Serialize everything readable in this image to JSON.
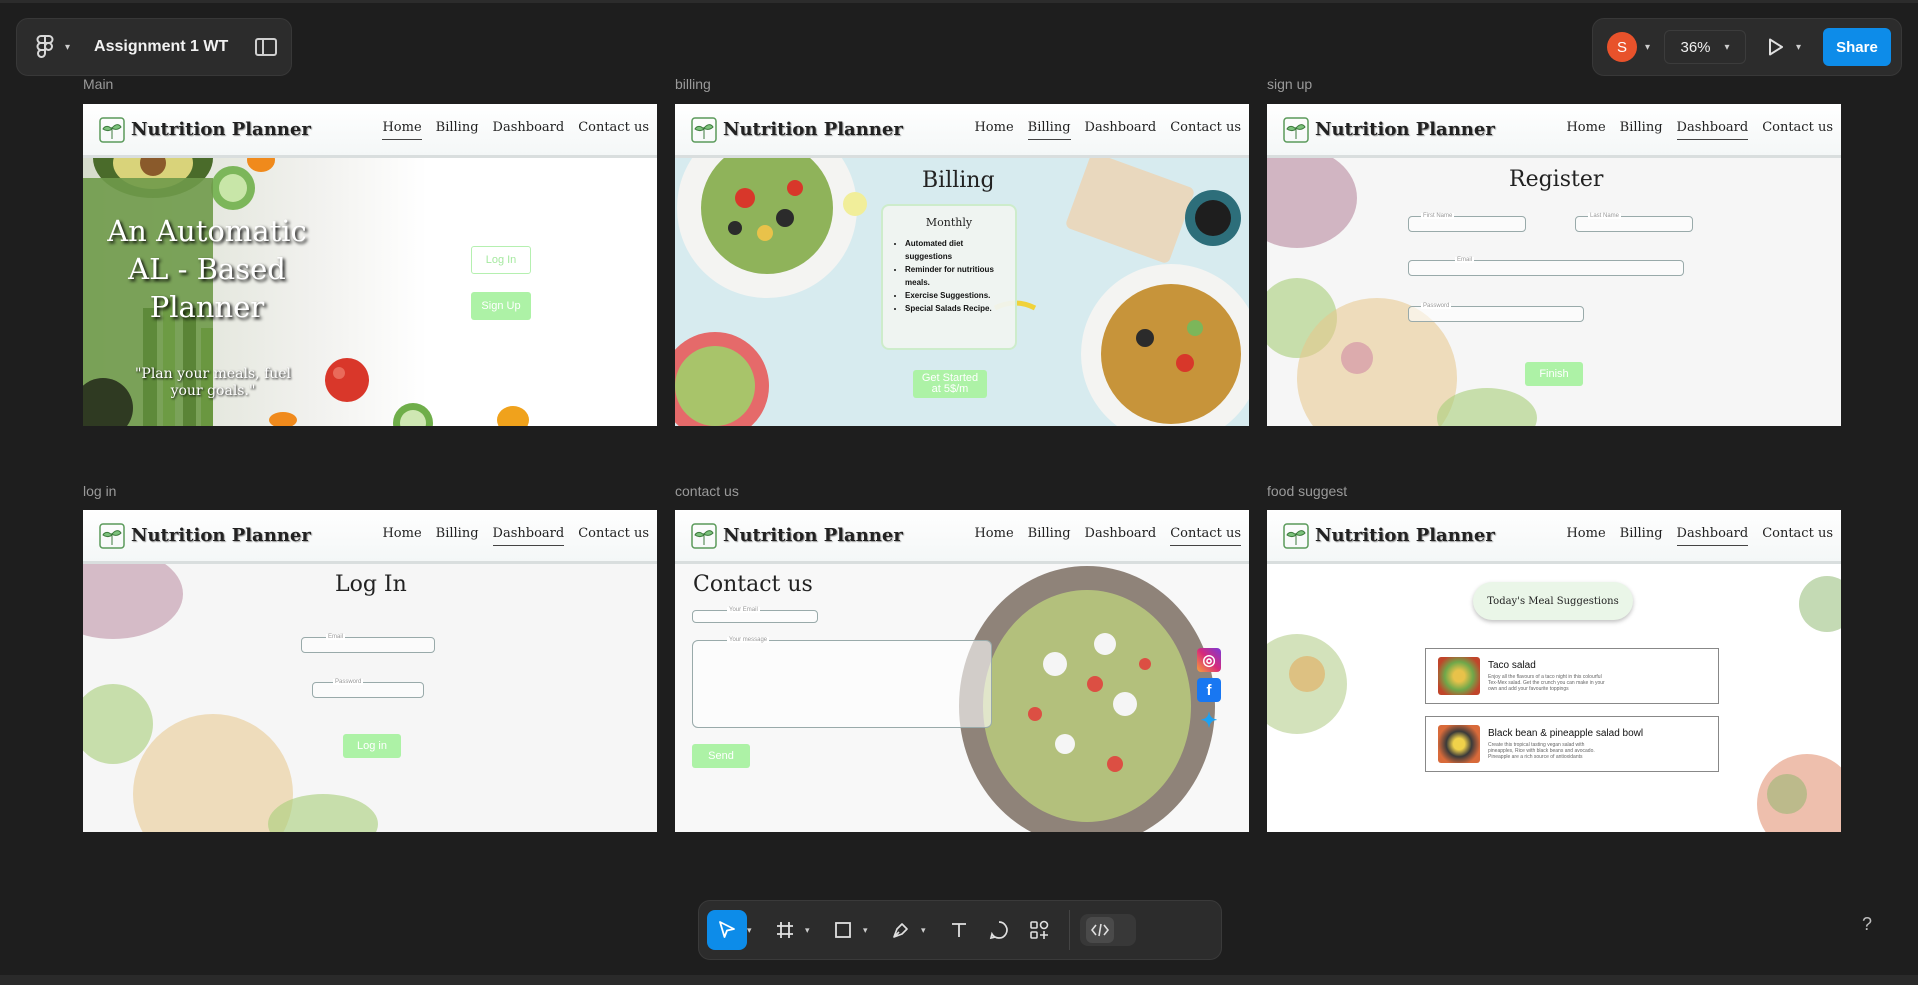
{
  "file": {
    "name": "Assignment 1 WT",
    "menu_icon": "figma-logo-icon",
    "sidebar_icon": "sidebar-toggle-icon"
  },
  "header_right": {
    "avatar_letter": "S",
    "avatar_color": "#e8522b",
    "zoom": "36%",
    "share_label": "Share",
    "share_color": "#0d8ce9"
  },
  "site": {
    "brand": "Nutrition Planner",
    "nav": [
      "Home",
      "Billing",
      "Dashboard",
      "Contact us"
    ],
    "accent": "#adf2a6"
  },
  "frames": {
    "main": {
      "label": "Main",
      "title": "An Automatic AL - Based Planner",
      "quote": "\"Plan your meals, fuel your goals.\"",
      "login_btn": "Log In",
      "signup_btn": "Sign Up"
    },
    "billing": {
      "label": "billing",
      "title": "Billing",
      "card_title": "Monthly",
      "features": [
        "Automated diet suggestions",
        "Reminder for nutritious meals.",
        "Exercise Suggestions.",
        "Special Salads Recipe."
      ],
      "cta": "Get Started at 5$/m"
    },
    "signup": {
      "label": "sign up",
      "title": "Register",
      "first_name": "First Name",
      "last_name": "Last Name",
      "email": "Email",
      "password": "Password",
      "finish_btn": "Finish"
    },
    "login": {
      "label": "log in",
      "title": "Log In",
      "email": "Email",
      "password": "Password",
      "login_btn": "Log in"
    },
    "contact": {
      "label": "contact us",
      "title": "Contact us",
      "email": "Your Email",
      "message": "Your message",
      "send_btn": "Send"
    },
    "food": {
      "label": "food suggest",
      "heading": "Today's Meal Suggestions",
      "meals": [
        {
          "name": "Taco salad",
          "desc": "Enjoy all the flavours of a taco night in this colourful Tex-Mex salad. Get the crunch you can make in your own and add your favourite toppings"
        },
        {
          "name": "Black bean & pineapple salad bowl",
          "desc": "Create this tropical tasting vegan salad with pineapples, Rice with black beans and avocado. Pineapple are a rich source of antioxidants"
        }
      ]
    }
  },
  "toolbar": {
    "tools": [
      "move-icon",
      "frame-icon",
      "rectangle-icon",
      "pen-icon",
      "text-icon",
      "comment-icon",
      "actions-icon"
    ],
    "devmode_icon": "code-icon"
  },
  "help": "?"
}
